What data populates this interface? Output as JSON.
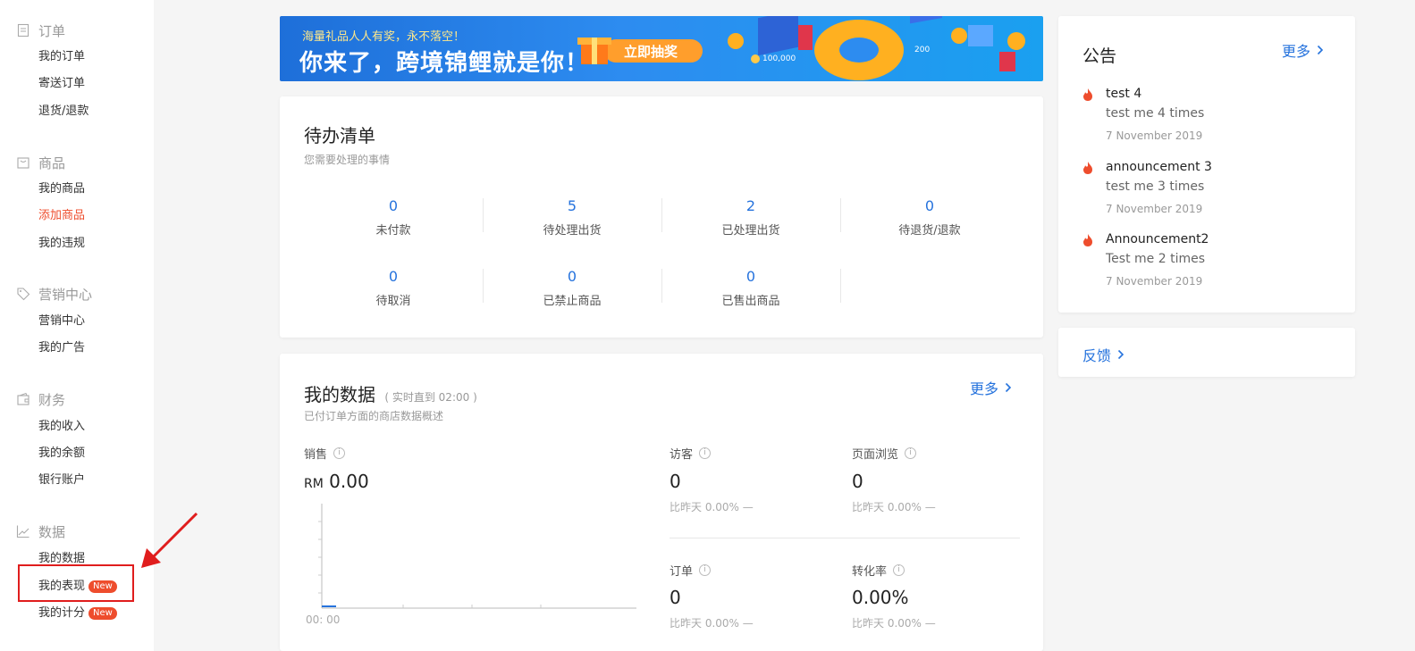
{
  "sidebar": {
    "groups": [
      {
        "icon": "clipboard-icon",
        "title": "订单",
        "items": [
          "我的订单",
          "寄送订单",
          "退货/退款"
        ]
      },
      {
        "icon": "bag-icon",
        "title": "商品",
        "items": [
          "我的商品",
          "添加商品",
          "我的违规"
        ]
      },
      {
        "icon": "tag-icon",
        "title": "营销中心",
        "items": [
          "营销中心",
          "我的广告"
        ]
      },
      {
        "icon": "wallet-icon",
        "title": "财务",
        "items": [
          "我的收入",
          "我的余额",
          "银行账户"
        ]
      },
      {
        "icon": "line-chart-icon",
        "title": "数据",
        "items": [
          "我的数据",
          "我的表现",
          "我的计分"
        ]
      }
    ],
    "active_item": "添加商品",
    "new_badge": "New",
    "accent": "#ee4d2d"
  },
  "banner": {
    "subtitle": "海量礼品人人有奖，永不落空！",
    "title": "你来了，跨境锦鲤就是你！",
    "button": "立即抽奖",
    "coin_text_1": "100,000",
    "coin_text_2": "200"
  },
  "todo": {
    "title": "待办清单",
    "subtitle": "您需要处理的事情",
    "items": [
      {
        "value": "0",
        "label": "未付款"
      },
      {
        "value": "5",
        "label": "待处理出货"
      },
      {
        "value": "2",
        "label": "已处理出货"
      },
      {
        "value": "0",
        "label": "待退货/退款"
      },
      {
        "value": "0",
        "label": "待取消"
      },
      {
        "value": "0",
        "label": "已禁止商品"
      },
      {
        "value": "0",
        "label": "已售出商品"
      }
    ]
  },
  "mydata": {
    "title": "我的数据",
    "title_note": "( 实时直到 02:00 )",
    "subtitle": "已付订单方面的商店数据概述",
    "more": "更多",
    "sales": {
      "label": "销售",
      "currency": "RM",
      "value": "0.00",
      "chart_x_label": "00: 00"
    },
    "metrics": [
      {
        "label": "访客",
        "value": "0",
        "compare": "比昨天 0.00% —"
      },
      {
        "label": "页面浏览",
        "value": "0",
        "compare": "比昨天 0.00% —"
      },
      {
        "label": "订单",
        "value": "0",
        "compare": "比昨天 0.00% —"
      },
      {
        "label": "转化率",
        "value": "0.00%",
        "compare": "比昨天 0.00% —"
      }
    ]
  },
  "notice": {
    "title": "公告",
    "more": "更多",
    "items": [
      {
        "title": "test 4",
        "body": "test me 4 times",
        "date": "7 November 2019"
      },
      {
        "title": "announcement 3",
        "body": "test me 3 times",
        "date": "7 November 2019"
      },
      {
        "title": "Announcement2",
        "body": "Test me 2 times",
        "date": "7 November 2019"
      }
    ]
  },
  "feedback": {
    "label": "反馈"
  },
  "colors": {
    "link_blue": "#2673dd",
    "fire": "#ee4d2d",
    "annotation_red": "#e01d1d"
  }
}
